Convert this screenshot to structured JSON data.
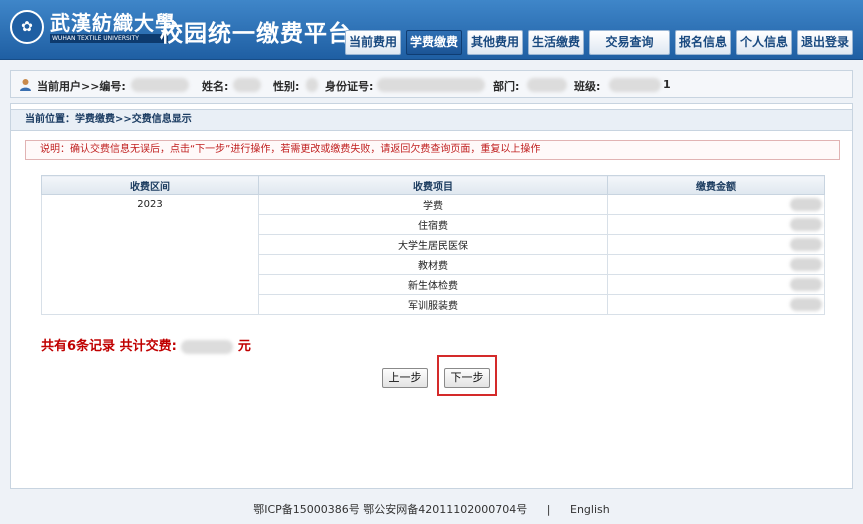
{
  "header": {
    "school_cn": "武漢紡織大學",
    "school_en": "WUHAN TEXTILE UNIVERSITY",
    "platform_title": "校园统一缴费平台",
    "nav": [
      {
        "label": "当前费用"
      },
      {
        "label": "学费缴费"
      },
      {
        "label": "其他费用"
      },
      {
        "label": "生活缴费"
      },
      {
        "label": "交易查询"
      },
      {
        "label": "报名信息"
      },
      {
        "label": "个人信息"
      },
      {
        "label": "退出登录"
      }
    ],
    "active_nav": "学费缴费"
  },
  "userbar": {
    "current_user": "当前用户>>编号:",
    "name_label": "姓名:",
    "gender_label": "性别:",
    "id_label": "身份证号:",
    "dept_label": "部门:",
    "class_label": "班级:",
    "class_tail": "1"
  },
  "breadcrumb": "当前位置：学费缴费>>交费信息显示",
  "notice": "说明：确认交费信息无误后，点击“下一步”进行操作，若需更改或缴费失败，请返回欠费查询页面，重复以上操作",
  "table": {
    "headers": [
      "收费区间",
      "收费项目",
      "缴费金额"
    ],
    "period": "2023",
    "rows": [
      {
        "item": "学费"
      },
      {
        "item": "住宿费"
      },
      {
        "item": "大学生居民医保"
      },
      {
        "item": "教材费"
      },
      {
        "item": "新生体检费"
      },
      {
        "item": "军训服装费"
      }
    ]
  },
  "summary": {
    "records_text": "共有6条记录",
    "total_label": "共计交费:",
    "unit": "元"
  },
  "buttons": {
    "prev": "上一步",
    "next": "下一步"
  },
  "footer": {
    "icp": "鄂ICP备15000386号 鄂公安网备42011102000704号",
    "sep": "|",
    "lang": "English"
  },
  "colors": {
    "header_blue": "#2a6fb5",
    "alert_red": "#c00000"
  }
}
